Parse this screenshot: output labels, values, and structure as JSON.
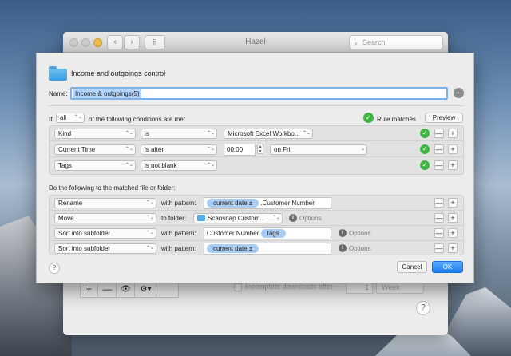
{
  "hazel": {
    "title": "Hazel",
    "search_placeholder": "Search",
    "nav_back": "‹",
    "nav_forward": "›",
    "grid_glyph": "⣿",
    "bottom_bar": {
      "add": "+",
      "remove": "—",
      "eye": "👁",
      "gear": "⚙▾"
    },
    "incomplete_label": "Incomplete downloads after",
    "incomplete_value": "1",
    "incomplete_unit": "Week",
    "help": "?"
  },
  "sheet": {
    "rule_title": "Income and outgoings control",
    "name_label": "Name:",
    "name_value": "Income & outgoings(5)",
    "name_action_glyph": "⋯",
    "if_label": "If",
    "if_scope": "all",
    "if_suffix": "of the following conditions are met",
    "rule_matches": "Rule matches",
    "preview": "Preview",
    "conditions": [
      {
        "attribute": "Kind",
        "operator": "is",
        "value": "Microsoft Excel Workbo..."
      },
      {
        "attribute": "Current Time",
        "operator": "is after",
        "time": "00:00",
        "extra": "on Fri"
      },
      {
        "attribute": "Tags",
        "operator": "is not blank"
      }
    ],
    "do_label": "Do the following to the matched file or folder:",
    "actions": [
      {
        "action": "Rename",
        "connector": "with pattern:",
        "tokens": [
          "current date ±"
        ],
        "text": ".Customer Number"
      },
      {
        "action": "Move",
        "connector": "to folder:",
        "folder": "Scansnap Custom...",
        "options": "Options"
      },
      {
        "action": "Sort into subfolder",
        "connector": "with pattern:",
        "text": "Customer Number",
        "tokens": [
          "tags"
        ],
        "options": "Options"
      },
      {
        "action": "Sort into subfolder",
        "connector": "with pattern:",
        "tokens": [
          "current date ±"
        ],
        "options": "Options"
      }
    ],
    "help": "?",
    "cancel": "Cancel",
    "ok": "OK"
  },
  "glyphs": {
    "check": "✓",
    "minus": "—",
    "plus": "+",
    "info": "i",
    "popup_arrows": "⌃⌄",
    "dropdown_arrow": "⌄",
    "stepper_up": "▲",
    "stepper_down": "▼",
    "search_icon": "⌕"
  },
  "colors": {
    "accent": "#1a7ff3",
    "match_green": "#3fb542",
    "token_blue": "#a9cdf4"
  }
}
